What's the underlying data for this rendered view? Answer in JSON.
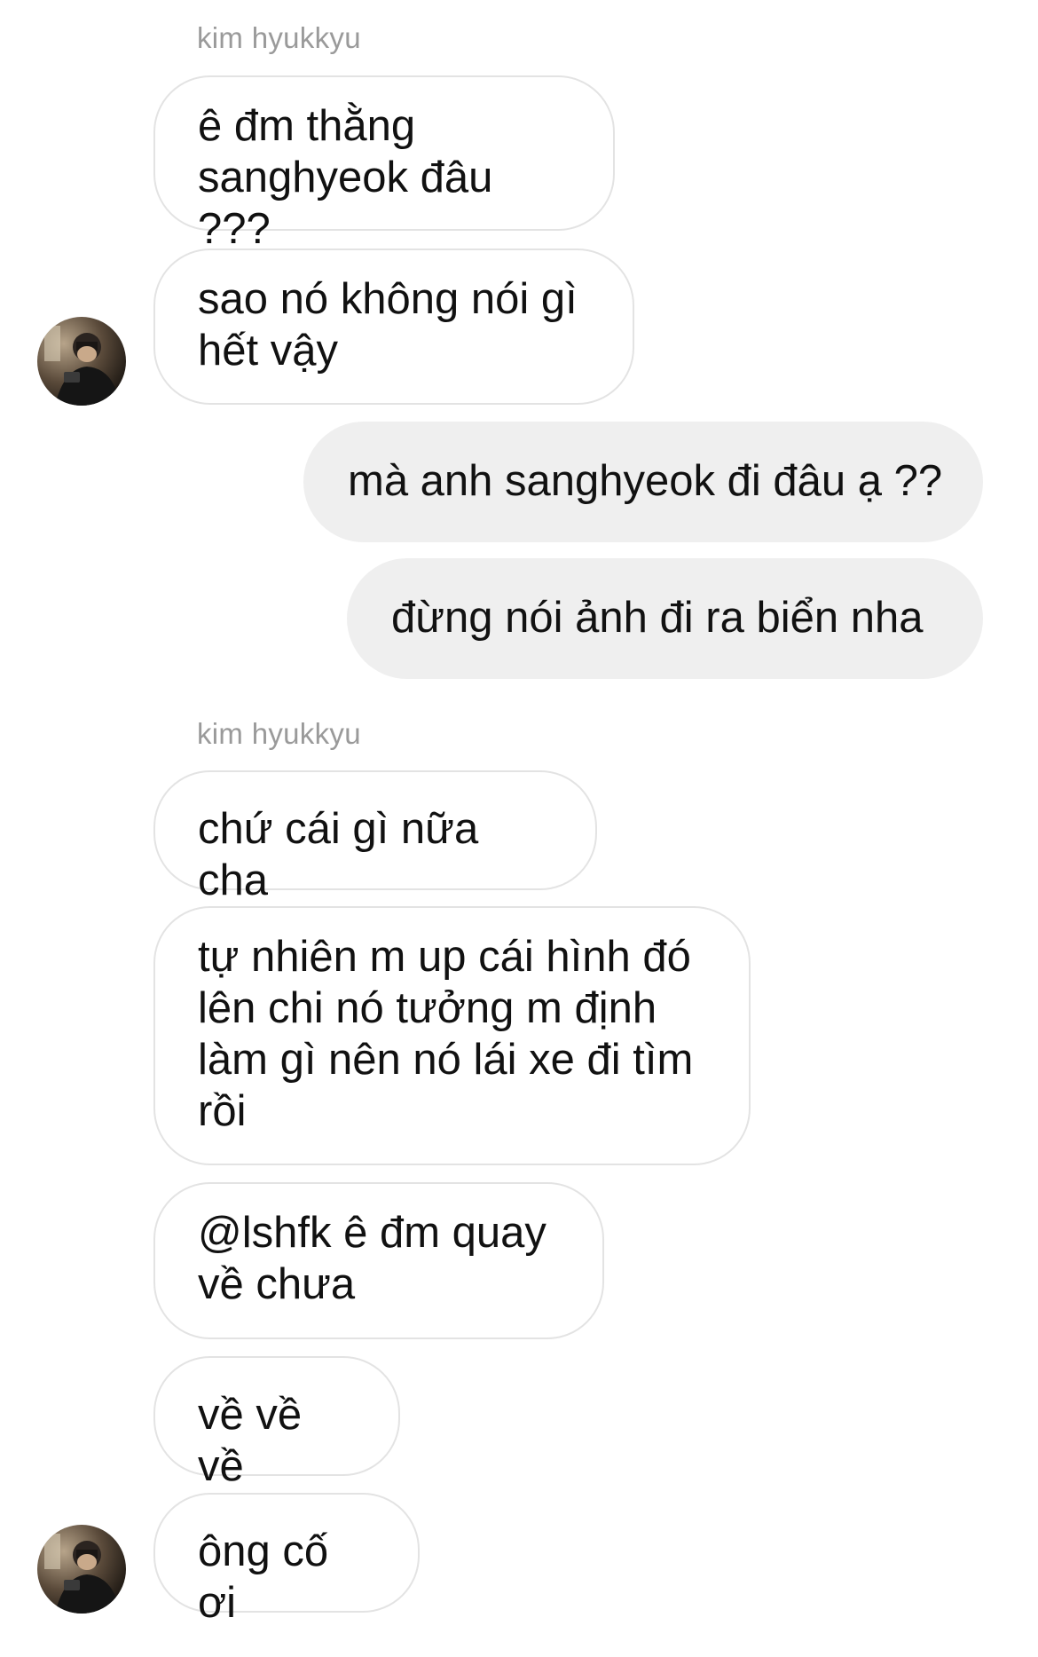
{
  "thread": {
    "groups": [
      {
        "sender": "kim hyukkyu",
        "messages": [
          "ê đm thằng\nsanghyeok đâu ???",
          "sao nó không nói gì\nhết vậy"
        ]
      },
      {
        "sender": "me",
        "messages": [
          "mà anh sanghyeok đi đâu ạ ??",
          "đừng nói ảnh đi ra biển nha"
        ]
      },
      {
        "sender": "kim hyukkyu",
        "messages": [
          "chứ cái gì nữa cha",
          "tự nhiên m up cái hình đó\nlên chi nó tưởng m định\nlàm gì nên nó lái xe đi tìm\nrồi",
          "@lshfk ê đm quay\nvề chưa",
          "về về về",
          "ông cố ơi"
        ]
      }
    ]
  },
  "avatar": {
    "icon": "profile-photo",
    "accent": "#2a2a2a"
  }
}
